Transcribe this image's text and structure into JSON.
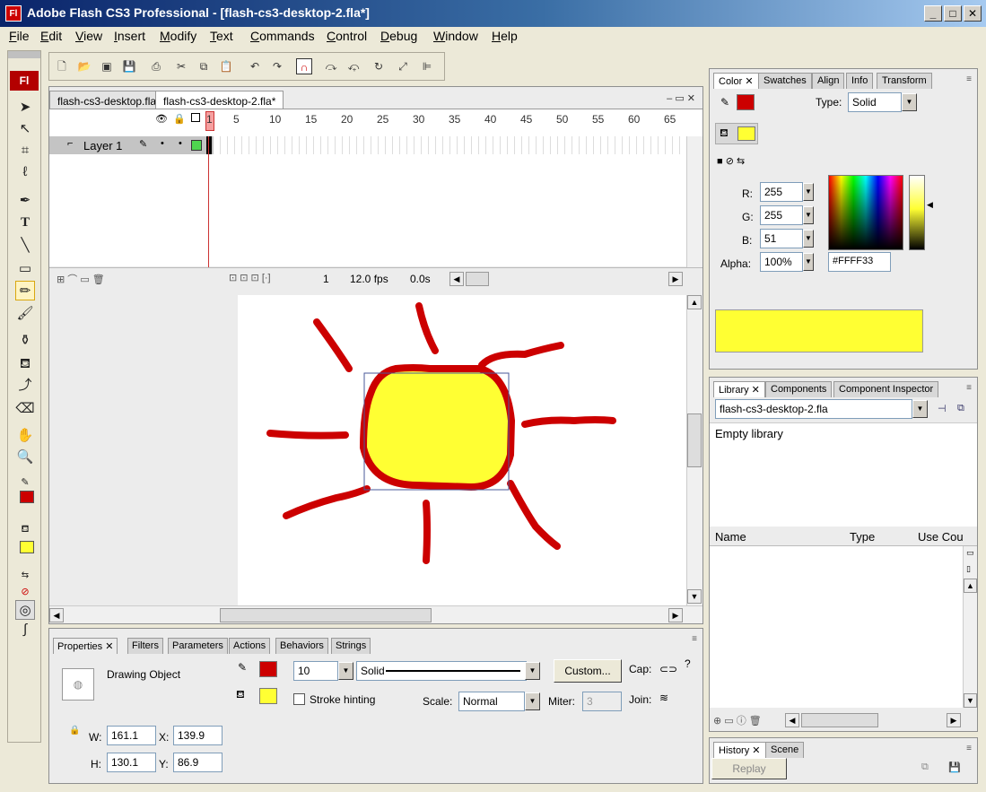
{
  "window": {
    "title": "Adobe Flash CS3 Professional - [flash-cs3-desktop-2.fla*]",
    "app_icon_text": "Fl"
  },
  "menu": [
    "File",
    "Edit",
    "View",
    "Insert",
    "Modify",
    "Text",
    "Commands",
    "Control",
    "Debug",
    "Window",
    "Help"
  ],
  "document_tabs": [
    "flash-cs3-desktop.fla",
    "flash-cs3-desktop-2.fla*"
  ],
  "timeline": {
    "frame_numbers": [
      "1",
      "5",
      "10",
      "15",
      "20",
      "25",
      "30",
      "35",
      "40",
      "45",
      "50",
      "55",
      "60",
      "65"
    ],
    "layer_name": "Layer 1",
    "current_frame": "1",
    "fps": "12.0 fps",
    "time": "0.0s"
  },
  "properties": {
    "tabs": [
      "Properties",
      "Filters",
      "Parameters",
      "Actions",
      "Behaviors",
      "Strings"
    ],
    "object_type": "Drawing Object",
    "stroke_size": "10",
    "stroke_style": "Solid",
    "custom_label": "Custom...",
    "cap_label": "Cap:",
    "join_label": "Join:",
    "stroke_hinting_label": "Stroke hinting",
    "scale_label": "Scale:",
    "scale_value": "Normal",
    "miter_label": "Miter:",
    "miter_value": "3",
    "w_label": "W:",
    "w_value": "161.1",
    "h_label": "H:",
    "h_value": "130.1",
    "x_label": "X:",
    "x_value": "139.9",
    "y_label": "Y:",
    "y_value": "86.9"
  },
  "color_panel": {
    "tabs": [
      "Color",
      "Swatches",
      "Align",
      "Info",
      "Transform"
    ],
    "type_label": "Type:",
    "type_value": "Solid",
    "r_label": "R:",
    "r_value": "255",
    "g_label": "G:",
    "g_value": "255",
    "b_label": "B:",
    "b_value": "51",
    "alpha_label": "Alpha:",
    "alpha_value": "100%",
    "hex_value": "#FFFF33",
    "fill_color": "#ffff33",
    "stroke_color": "#cc0000"
  },
  "library_panel": {
    "tabs": [
      "Library",
      "Components",
      "Component Inspector"
    ],
    "document": "flash-cs3-desktop-2.fla",
    "empty_text": "Empty library",
    "columns": [
      "Name",
      "Type",
      "Use Cou"
    ]
  },
  "history_panel": {
    "tabs": [
      "History",
      "Scene"
    ],
    "replay_label": "Replay"
  }
}
